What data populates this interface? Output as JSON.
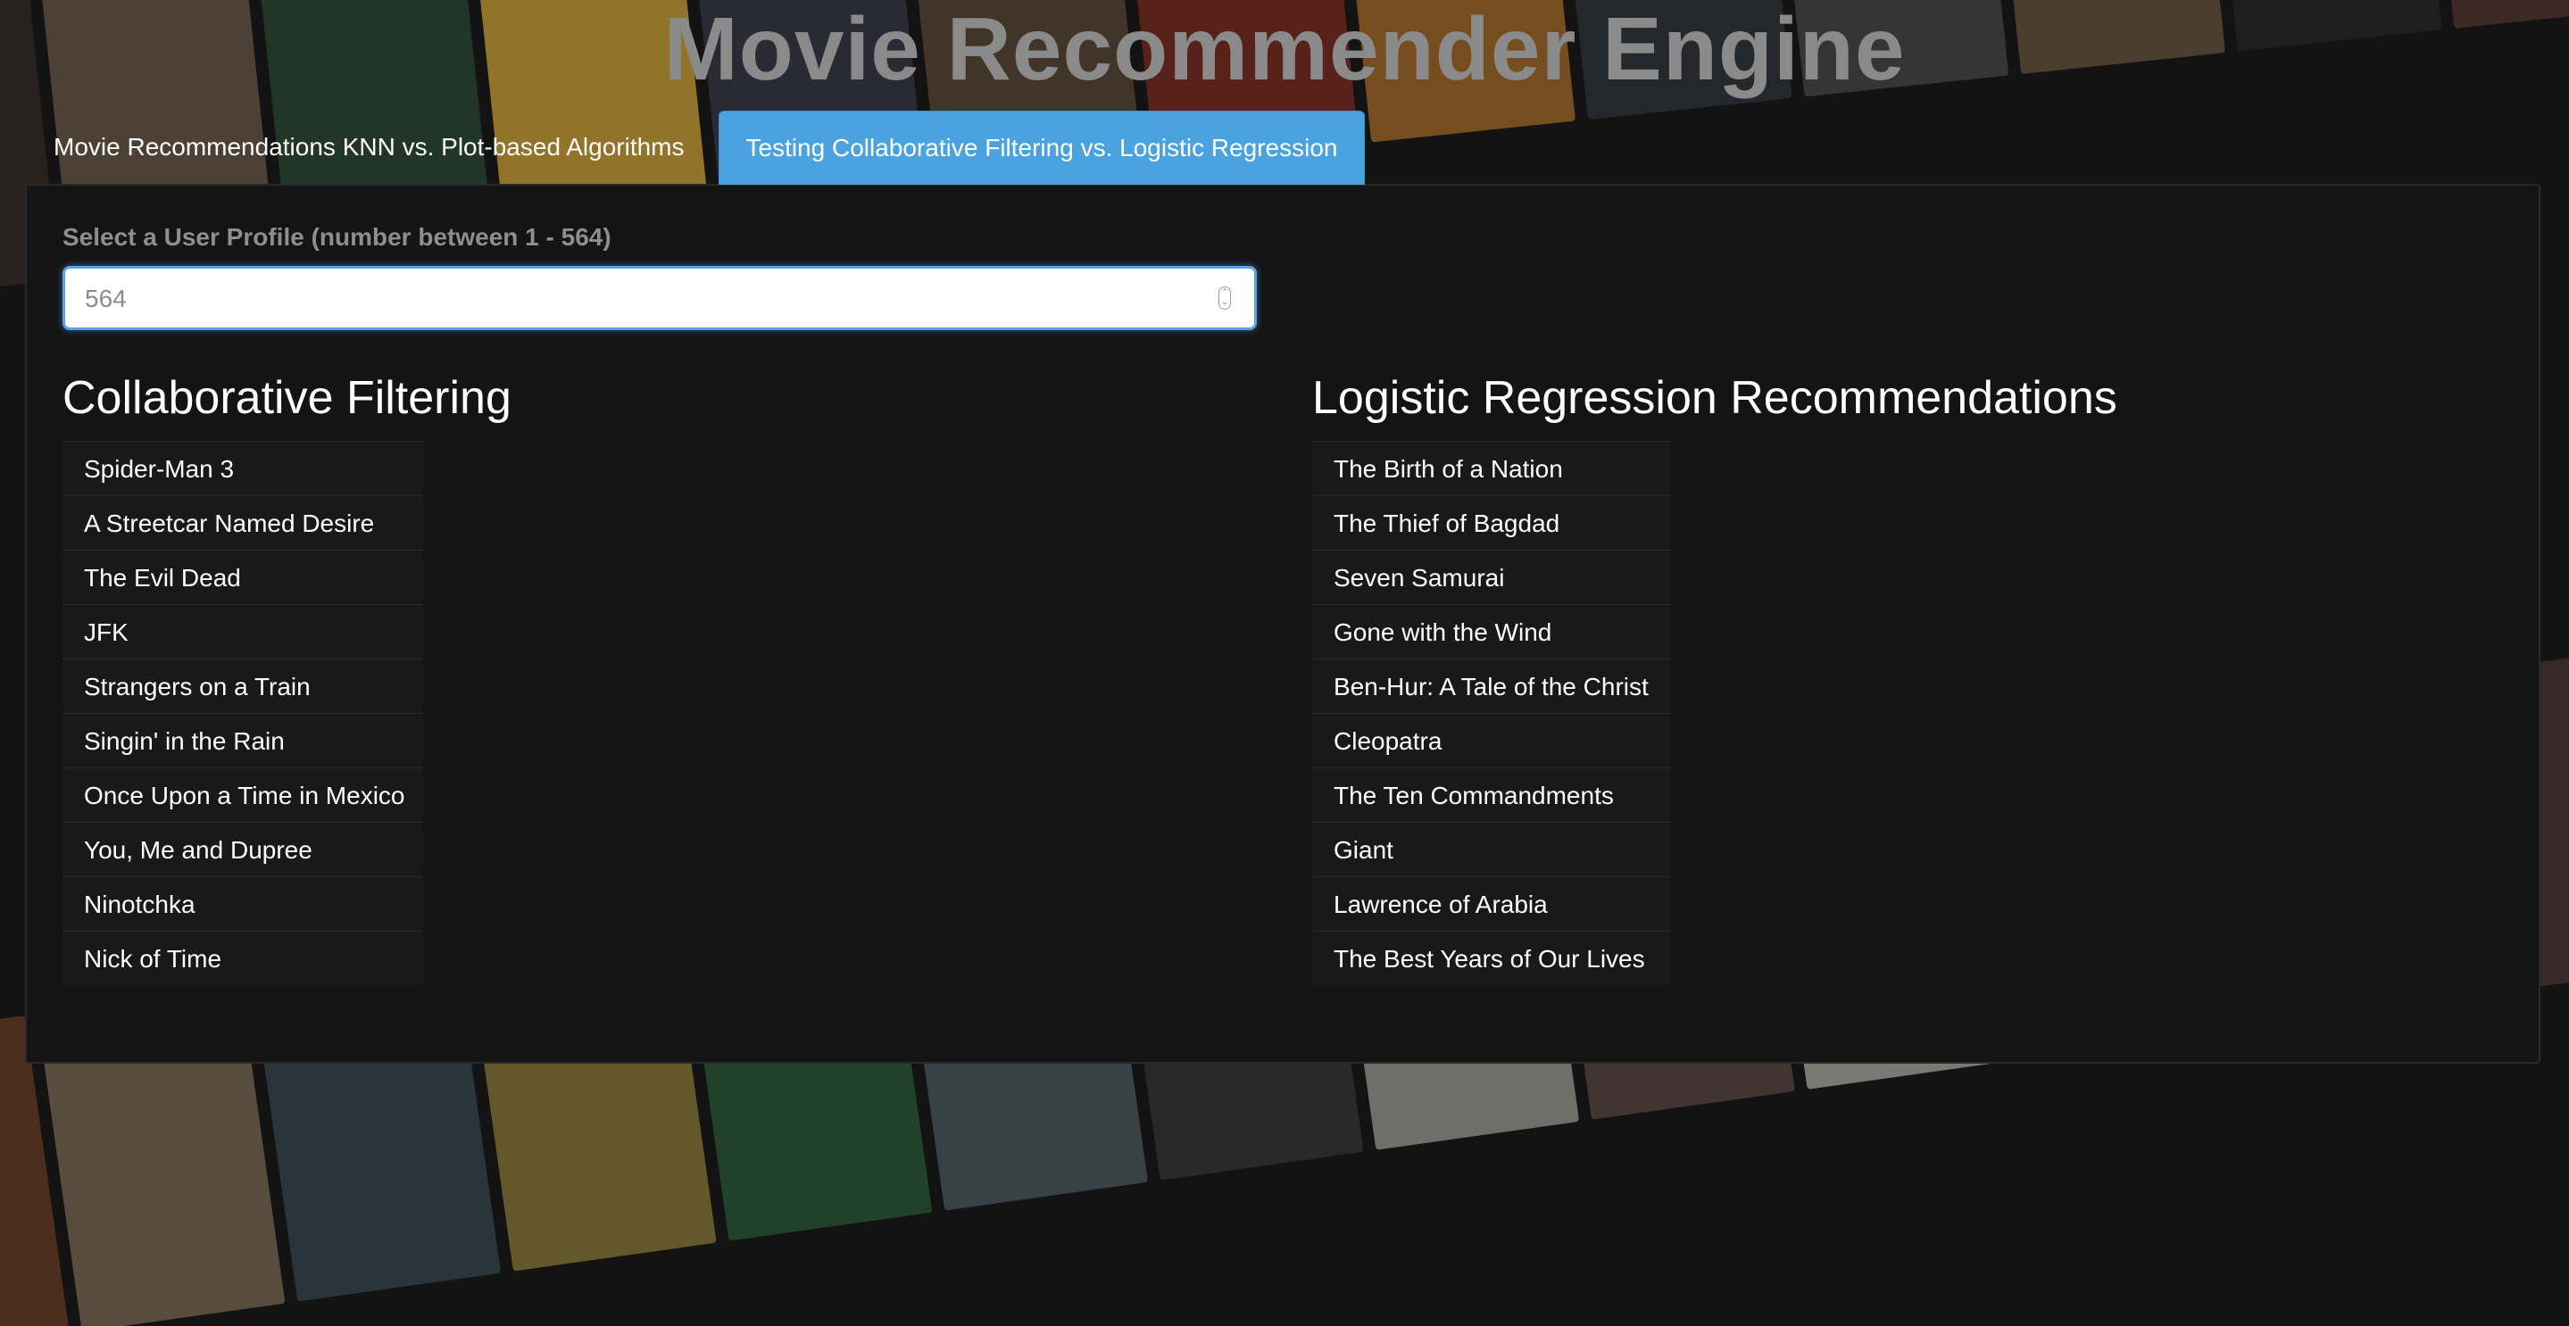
{
  "header": {
    "title": "Movie Recommender Engine"
  },
  "tabs": [
    {
      "label": "Movie Recommendations KNN vs. Plot-based Algorithms",
      "active": false
    },
    {
      "label": "Testing Collaborative Filtering vs. Logistic Regression",
      "active": true
    }
  ],
  "profile": {
    "label": "Select a User Profile (number between 1 - 564)",
    "value": "564"
  },
  "collaborative": {
    "heading": "Collaborative Filtering",
    "items": [
      "Spider-Man 3",
      "A Streetcar Named Desire",
      "The Evil Dead",
      "JFK",
      "Strangers on a Train",
      "Singin' in the Rain",
      "Once Upon a Time in Mexico",
      "You, Me and Dupree",
      "Ninotchka",
      "Nick of Time"
    ]
  },
  "logistic": {
    "heading": "Logistic Regression Recommendations",
    "items": [
      "The Birth of a Nation",
      "The Thief of Bagdad",
      "Seven Samurai",
      "Gone with the Wind",
      "Ben-Hur: A Tale of the Christ",
      "Cleopatra",
      "The Ten Commandments",
      "Giant",
      "Lawrence of Arabia",
      "The Best Years of Our Lives"
    ]
  },
  "colors": {
    "accent": "#4aa3df",
    "panel": "#141414",
    "title": "#8a8a8a"
  }
}
